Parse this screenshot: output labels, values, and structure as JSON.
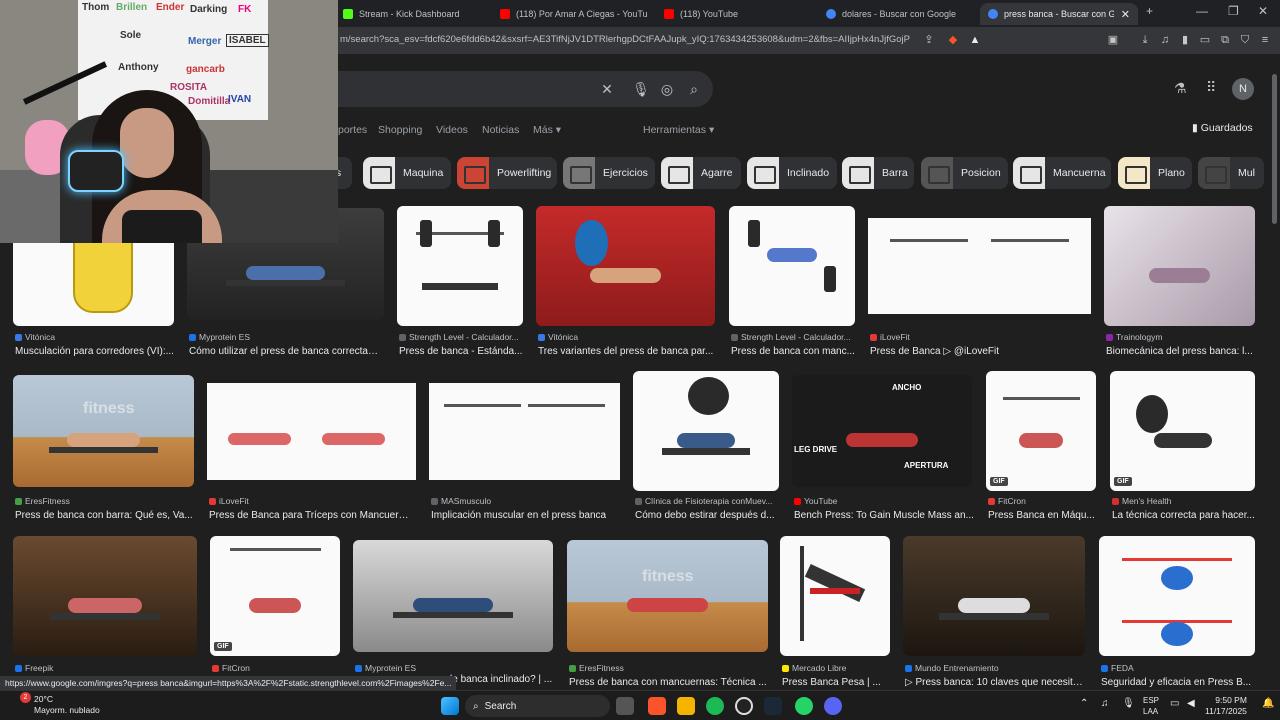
{
  "browser": {
    "tabs": [
      {
        "label": "Stream - Kick Dashboard",
        "color": "#53fc18"
      },
      {
        "label": "(118) Por Amar A Ciegas - YouTub",
        "color": "#ff0000"
      },
      {
        "label": "(118) YouTube",
        "color": "#ff0000"
      },
      {
        "label": "dolares - Buscar con Google",
        "color": "#4285f4"
      },
      {
        "label": "press banca - Buscar con Google",
        "color": "#4285f4"
      }
    ],
    "url": "m/search?sca_esv=fdcf620e6fdd6b42&sxsrf=AE3TifNjJV1DTRlerhgpDCtFAAJupk_yIQ:1763434253608&udm=2&fbs=AIIjpHx4nJjfGojPVHhE...",
    "new_tab": "+",
    "minimize": "—",
    "maximize": "❐",
    "close": "✕"
  },
  "google": {
    "avatar_letter": "N",
    "tabs": [
      "portes",
      "Shopping",
      "Videos",
      "Noticias",
      "Más ▾"
    ],
    "tools": "Herramientas ▾",
    "saved": "Guardados",
    "clear_icon": "✕"
  },
  "chips": [
    "ps",
    "Maquina",
    "Powerlifting",
    "Ejercicios",
    "Agarre",
    "Inclinado",
    "Barra",
    "Posicion",
    "Mancuerna",
    "Plano",
    "Mul"
  ],
  "results": {
    "row1": [
      {
        "source": "Vitónica",
        "caption": "Musculación para corredores (VI):...",
        "color": "#3b78e7"
      },
      {
        "source": "Myprotein ES",
        "caption": "Cómo utilizar el press de banca correctam...",
        "color": "#1a73e8"
      },
      {
        "source": "Strength Level - Calculador...",
        "caption": "Press de banca - Estánda...",
        "color": "#5f6368"
      },
      {
        "source": "Vitónica",
        "caption": "Tres variantes del press de banca par...",
        "color": "#3b78e7"
      },
      {
        "source": "Strength Level - Calculador...",
        "caption": "Press de banca con manc...",
        "color": "#5f6368"
      },
      {
        "source": "iLoveFit",
        "caption": "Press de Banca ▷ @iLoveFit",
        "color": "#e53935"
      },
      {
        "source": "Trainologym",
        "caption": "Biomecánica del press banca: l...",
        "color": "#8e24aa"
      }
    ],
    "row2": [
      {
        "source": "EresFitness",
        "caption": "Press de banca con barra: Qué es, Va...",
        "color": "#43a047"
      },
      {
        "source": "iLoveFit",
        "caption": "Press de Banca para Tríceps con Mancuerna...",
        "color": "#e53935"
      },
      {
        "source": "MASmusculo",
        "caption": "Implicación muscular en el press banca",
        "color": "#5f6368"
      },
      {
        "source": "Clínica de Fisioterapia conMuev...",
        "caption": "Cómo debo estirar después d...",
        "color": "#5f6368"
      },
      {
        "source": "YouTube",
        "caption": "Bench Press: To Gain Muscle Mass an...",
        "color": "#ff0000"
      },
      {
        "source": "FitCron",
        "caption": "Press Banca en Máqu...",
        "color": "#e53935"
      },
      {
        "source": "Men's Health",
        "caption": "La técnica correcta para hacer...",
        "color": "#d32f2f"
      }
    ],
    "row3": [
      {
        "source": "Freepik",
        "caption": "",
        "color": "#1a73e8"
      },
      {
        "source": "FitCron",
        "caption": "",
        "color": "#e53935"
      },
      {
        "source": "Myprotein ES",
        "caption": "ress de banca inclinado? | ...",
        "color": "#1a73e8"
      },
      {
        "source": "EresFitness",
        "caption": "Press de banca con mancuernas: Técnica ...",
        "color": "#43a047"
      },
      {
        "source": "Mercado Libre",
        "caption": "Press Banca Pesa | ...",
        "color": "#ffe600"
      },
      {
        "source": "Mundo Entrenamiento",
        "caption": "▷ Press banca: 10 claves que necesita...",
        "color": "#1a73e8"
      },
      {
        "source": "FEDA",
        "caption": "Seguridad y eficacia en Press B...",
        "color": "#1a73e8"
      }
    ],
    "overlay": {
      "ancho": "ANCHO",
      "leg_drive": "LEG DRIVE",
      "apertura": "APERTURA",
      "fitness": "fitness",
      "gif": "GIF"
    }
  },
  "status_url": "https://www.google.com/imgres?q=press banca&imgurl=https%3A%2F%2Fstatic.strengthlevel.com%2Fimages%2Fe...",
  "taskbar": {
    "weather_temp": "20°C",
    "weather_desc": "Mayorm. nublado",
    "weather_badge": "2",
    "search": "Search",
    "lang1": "ESP",
    "lang2": "LAA",
    "time": "9:50 PM",
    "date": "11/17/2025"
  },
  "webcam": {
    "names": [
      "Thom",
      "Brillen",
      "Ender",
      "Darking",
      "FK",
      "Sole",
      "Merger",
      "ISABEL",
      "Anthony",
      "gancarb",
      "ROSITA",
      "Domitilla",
      "IVAN"
    ]
  }
}
